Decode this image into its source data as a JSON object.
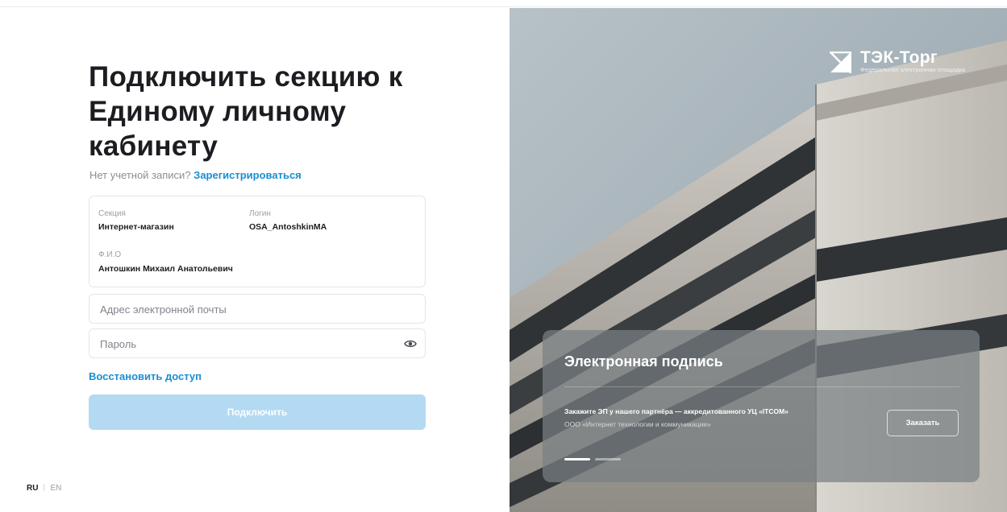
{
  "form": {
    "title": "Подключить секцию к Единому личному кабинету",
    "no_account_text": "Нет учетной записи?",
    "register_link": "Зарегистрироваться",
    "info": {
      "section_label": "Секция",
      "section_value": "Интернет-магазин",
      "login_label": "Логин",
      "login_value": "OSA_AntoshkinMA",
      "fio_label": "Ф.И.О",
      "fio_value": "Антошкин Михаил Анатольевич"
    },
    "email_placeholder": "Адрес электронной почты",
    "password_placeholder": "Пароль",
    "password_toggle_icon": "eye-icon",
    "restore_link": "Восстановить доступ",
    "submit_label": "Подключить"
  },
  "language": {
    "current": "RU",
    "other": "EN"
  },
  "brand": {
    "name": "ТЭК-Торг",
    "subtitle": "Федеральная электронная площадка"
  },
  "promo": {
    "title": "Электронная подпись",
    "text_main": "Закажите ЭП у нашего партнёра — аккредитованного УЦ «ITCOM»",
    "text_sub": "ООО «Интернет технологии и коммуникации»",
    "button_label": "Заказать",
    "slides_total": 2,
    "slide_active": 1
  },
  "colors": {
    "accent": "#1a8ed1",
    "button_disabled": "#b3daf2",
    "text_dark": "#1b1d21"
  }
}
